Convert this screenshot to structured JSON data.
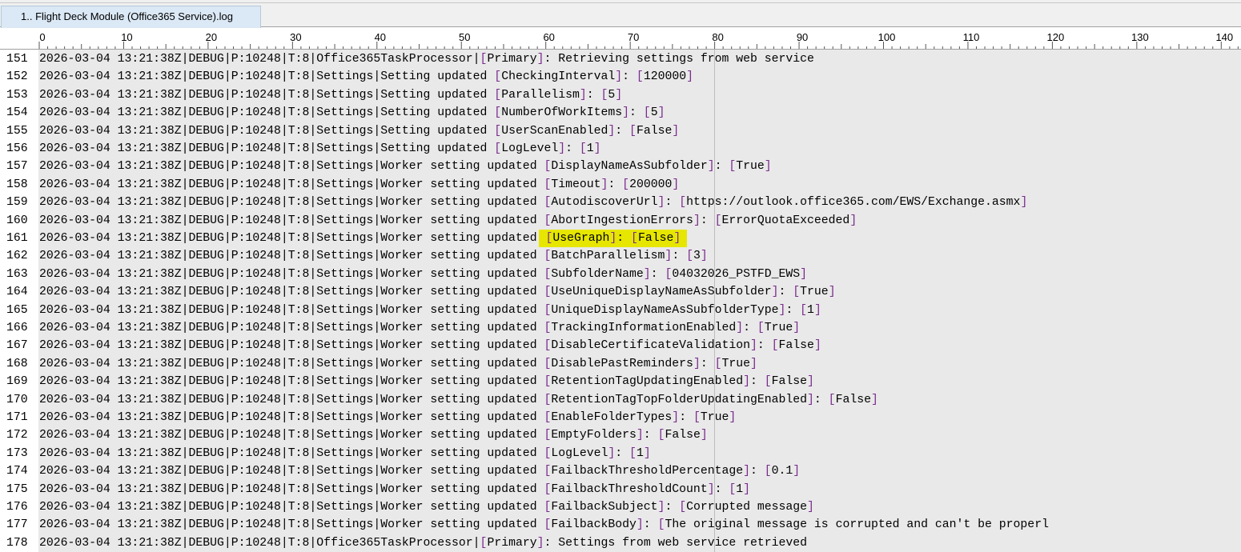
{
  "tab": {
    "label": "1.. Flight Deck Module (Office365 Service).log"
  },
  "ruler": {
    "labels": [
      "0",
      "10",
      "20",
      "30",
      "40",
      "50",
      "60",
      "70",
      "80",
      "90",
      "100",
      "110",
      "120",
      "130",
      "140"
    ]
  },
  "lines": [
    {
      "n": "151",
      "pre": "2026-03-04 13:21:38Z|DEBUG|P:10248|T:8|Office365TaskProcessor|",
      "key": "[Primary]",
      "sep": ": Retrieving settings from web service",
      "val": ""
    },
    {
      "n": "152",
      "pre": "2026-03-04 13:21:38Z|DEBUG|P:10248|T:8|Settings|Setting updated ",
      "key": "[CheckingInterval]",
      "sep": ": ",
      "val": "[120000]"
    },
    {
      "n": "153",
      "pre": "2026-03-04 13:21:38Z|DEBUG|P:10248|T:8|Settings|Setting updated ",
      "key": "[Parallelism]",
      "sep": ": ",
      "val": "[5]"
    },
    {
      "n": "154",
      "pre": "2026-03-04 13:21:38Z|DEBUG|P:10248|T:8|Settings|Setting updated ",
      "key": "[NumberOfWorkItems]",
      "sep": ": ",
      "val": "[5]"
    },
    {
      "n": "155",
      "pre": "2026-03-04 13:21:38Z|DEBUG|P:10248|T:8|Settings|Setting updated ",
      "key": "[UserScanEnabled]",
      "sep": ": ",
      "val": "[False]"
    },
    {
      "n": "156",
      "pre": "2026-03-04 13:21:38Z|DEBUG|P:10248|T:8|Settings|Setting updated ",
      "key": "[LogLevel]",
      "sep": ": ",
      "val": "[1]"
    },
    {
      "n": "157",
      "pre": "2026-03-04 13:21:38Z|DEBUG|P:10248|T:8|Settings|Worker setting updated ",
      "key": "[DisplayNameAsSubfolder]",
      "sep": ": ",
      "val": "[True]"
    },
    {
      "n": "158",
      "pre": "2026-03-04 13:21:38Z|DEBUG|P:10248|T:8|Settings|Worker setting updated ",
      "key": "[Timeout]",
      "sep": ": ",
      "val": "[200000]"
    },
    {
      "n": "159",
      "pre": "2026-03-04 13:21:38Z|DEBUG|P:10248|T:8|Settings|Worker setting updated ",
      "key": "[AutodiscoverUrl]",
      "sep": ": ",
      "val": "[https://outlook.office365.com/EWS/Exchange.asmx]"
    },
    {
      "n": "160",
      "pre": "2026-03-04 13:21:38Z|DEBUG|P:10248|T:8|Settings|Worker setting updated ",
      "key": "[AbortIngestionErrors]",
      "sep": ": ",
      "val": "[ErrorQuotaExceeded]"
    },
    {
      "n": "161",
      "pre": "2026-03-04 13:21:38Z|DEBUG|P:10248|T:8|Settings|Worker setting updated ",
      "key": "[UseGraph]",
      "sep": ": ",
      "val": "[False]",
      "highlight": true
    },
    {
      "n": "162",
      "pre": "2026-03-04 13:21:38Z|DEBUG|P:10248|T:8|Settings|Worker setting updated ",
      "key": "[BatchParallelism]",
      "sep": ": ",
      "val": "[3]"
    },
    {
      "n": "163",
      "pre": "2026-03-04 13:21:38Z|DEBUG|P:10248|T:8|Settings|Worker setting updated ",
      "key": "[SubfolderName]",
      "sep": ": ",
      "val": "[04032026_PSTFD_EWS]"
    },
    {
      "n": "164",
      "pre": "2026-03-04 13:21:38Z|DEBUG|P:10248|T:8|Settings|Worker setting updated ",
      "key": "[UseUniqueDisplayNameAsSubfolder]",
      "sep": ": ",
      "val": "[True]"
    },
    {
      "n": "165",
      "pre": "2026-03-04 13:21:38Z|DEBUG|P:10248|T:8|Settings|Worker setting updated ",
      "key": "[UniqueDisplayNameAsSubfolderType]",
      "sep": ": ",
      "val": "[1]"
    },
    {
      "n": "166",
      "pre": "2026-03-04 13:21:38Z|DEBUG|P:10248|T:8|Settings|Worker setting updated ",
      "key": "[TrackingInformationEnabled]",
      "sep": ": ",
      "val": "[True]"
    },
    {
      "n": "167",
      "pre": "2026-03-04 13:21:38Z|DEBUG|P:10248|T:8|Settings|Worker setting updated ",
      "key": "[DisableCertificateValidation]",
      "sep": ": ",
      "val": "[False]"
    },
    {
      "n": "168",
      "pre": "2026-03-04 13:21:38Z|DEBUG|P:10248|T:8|Settings|Worker setting updated ",
      "key": "[DisablePastReminders]",
      "sep": ": ",
      "val": "[True]"
    },
    {
      "n": "169",
      "pre": "2026-03-04 13:21:38Z|DEBUG|P:10248|T:8|Settings|Worker setting updated ",
      "key": "[RetentionTagUpdatingEnabled]",
      "sep": ": ",
      "val": "[False]"
    },
    {
      "n": "170",
      "pre": "2026-03-04 13:21:38Z|DEBUG|P:10248|T:8|Settings|Worker setting updated ",
      "key": "[RetentionTagTopFolderUpdatingEnabled]",
      "sep": ": ",
      "val": "[False]"
    },
    {
      "n": "171",
      "pre": "2026-03-04 13:21:38Z|DEBUG|P:10248|T:8|Settings|Worker setting updated ",
      "key": "[EnableFolderTypes]",
      "sep": ": ",
      "val": "[True]"
    },
    {
      "n": "172",
      "pre": "2026-03-04 13:21:38Z|DEBUG|P:10248|T:8|Settings|Worker setting updated ",
      "key": "[EmptyFolders]",
      "sep": ": ",
      "val": "[False]"
    },
    {
      "n": "173",
      "pre": "2026-03-04 13:21:38Z|DEBUG|P:10248|T:8|Settings|Worker setting updated ",
      "key": "[LogLevel]",
      "sep": ": ",
      "val": "[1]"
    },
    {
      "n": "174",
      "pre": "2026-03-04 13:21:38Z|DEBUG|P:10248|T:8|Settings|Worker setting updated ",
      "key": "[FailbackThresholdPercentage]",
      "sep": ": ",
      "val": "[0.1]"
    },
    {
      "n": "175",
      "pre": "2026-03-04 13:21:38Z|DEBUG|P:10248|T:8|Settings|Worker setting updated ",
      "key": "[FailbackThresholdCount]",
      "sep": ": ",
      "val": "[1]"
    },
    {
      "n": "176",
      "pre": "2026-03-04 13:21:38Z|DEBUG|P:10248|T:8|Settings|Worker setting updated ",
      "key": "[FailbackSubject]",
      "sep": ": ",
      "val": "[Corrupted message]"
    },
    {
      "n": "177",
      "pre": "2026-03-04 13:21:38Z|DEBUG|P:10248|T:8|Settings|Worker setting updated ",
      "key": "[FailbackBody]",
      "sep": ": ",
      "val": "[The original message is corrupted and can't be properl"
    },
    {
      "n": "178",
      "pre": "2026-03-04 13:21:38Z|DEBUG|P:10248|T:8|Office365TaskProcessor|",
      "key": "[Primary]",
      "sep": ": Settings from web service retrieved",
      "val": ""
    }
  ]
}
